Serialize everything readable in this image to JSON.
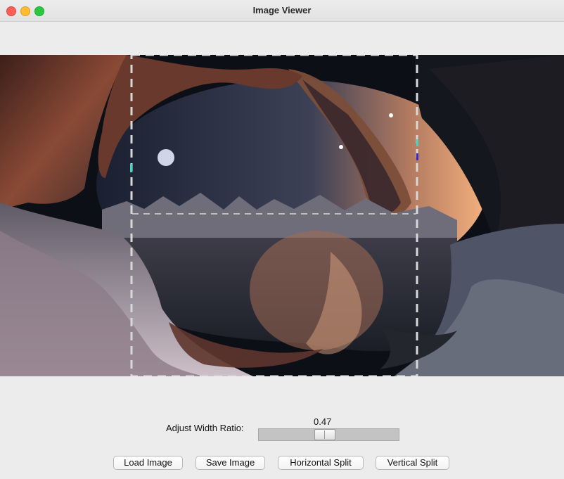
{
  "window": {
    "title": "Image Viewer"
  },
  "controls": {
    "ratio_label": "Adjust Width Ratio:",
    "ratio_value": "0.47",
    "ratio_slider_value": 0.47
  },
  "buttons": {
    "load": "Load Image",
    "save": "Save Image",
    "horizontal_split": "Horizontal Split",
    "vertical_split": "Vertical Split"
  },
  "colors": {
    "titlebar_bg": "#ececec",
    "window_bg": "#ececec",
    "close": "#ff5f57",
    "minimize": "#febc2e",
    "maximize": "#28c840",
    "guide_line": "#d8d8d8"
  },
  "icons": {
    "close": "close-icon",
    "minimize": "minimize-icon",
    "maximize": "maximize-icon"
  }
}
